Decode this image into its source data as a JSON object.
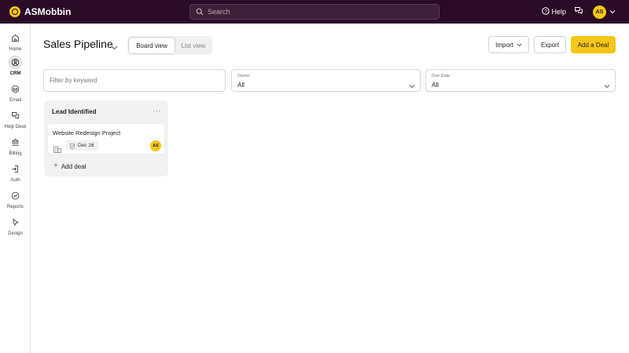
{
  "app": {
    "name": "ASMobbin"
  },
  "topbar": {
    "search_placeholder": "Search",
    "help_label": "Help",
    "user_initials": "AS"
  },
  "sidebar": {
    "items": [
      {
        "label": "Home",
        "icon": "home-icon"
      },
      {
        "label": "CRM",
        "icon": "crm-icon",
        "active": true
      },
      {
        "label": "Email",
        "icon": "email-icon"
      },
      {
        "label": "Help Desk",
        "icon": "help-desk-icon"
      },
      {
        "label": "Billing",
        "icon": "billing-icon"
      },
      {
        "label": "Auth",
        "icon": "auth-icon"
      },
      {
        "label": "Reports",
        "icon": "reports-icon"
      },
      {
        "label": "Design",
        "icon": "design-icon"
      }
    ]
  },
  "header": {
    "title": "Sales Pipeline",
    "views": {
      "board": "Board view",
      "list": "List view",
      "active": "board"
    },
    "import_label": "Import",
    "export_label": "Export",
    "add_deal_label": "Add a Deal"
  },
  "filters": {
    "keyword_placeholder": "Filter by keyword",
    "owner": {
      "label": "Owner",
      "value": "All"
    },
    "due_date": {
      "label": "Due Date",
      "value": "All"
    }
  },
  "board": {
    "columns": [
      {
        "title": "Lead Identified",
        "deals": [
          {
            "title": "Website Redesign Project",
            "due": "Dec 26",
            "owner_initials": "AS"
          }
        ],
        "add_label": "Add deal"
      }
    ]
  },
  "colors": {
    "topbar_bg": "#2a0c27",
    "accent": "#f5c518"
  }
}
